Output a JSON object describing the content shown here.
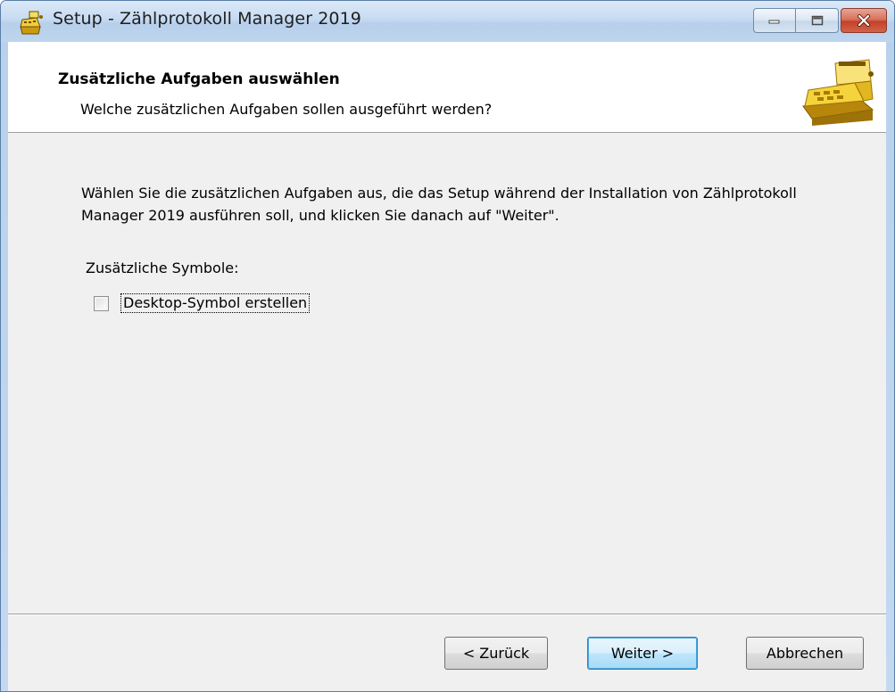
{
  "window": {
    "title": "Setup - Zählprotokoll Manager 2019"
  },
  "header": {
    "title": "Zusätzliche Aufgaben auswählen",
    "subtitle": "Welche zusätzlichen Aufgaben sollen ausgeführt werden?"
  },
  "content": {
    "intro": "Wählen Sie die zusätzlichen Aufgaben aus, die das Setup während der Installation von Zählprotokoll Manager 2019 ausführen soll, und klicken Sie danach auf \"Weiter\".",
    "group_label": "Zusätzliche Symbole:",
    "tasks": [
      {
        "label": "Desktop-Symbol erstellen",
        "checked": false
      }
    ]
  },
  "buttons": {
    "back": "< Zurück",
    "next": "Weiter >",
    "cancel": "Abbrechen"
  },
  "icons": {
    "app": "cash-register-icon",
    "header_image": "cash-register-icon",
    "minimize": "minimize-icon",
    "maximize": "maximize-icon",
    "close": "close-icon"
  },
  "colors": {
    "title_bar": "#c6dbf2",
    "close_button": "#c4402a",
    "default_button_border": "#3c7fb1"
  }
}
